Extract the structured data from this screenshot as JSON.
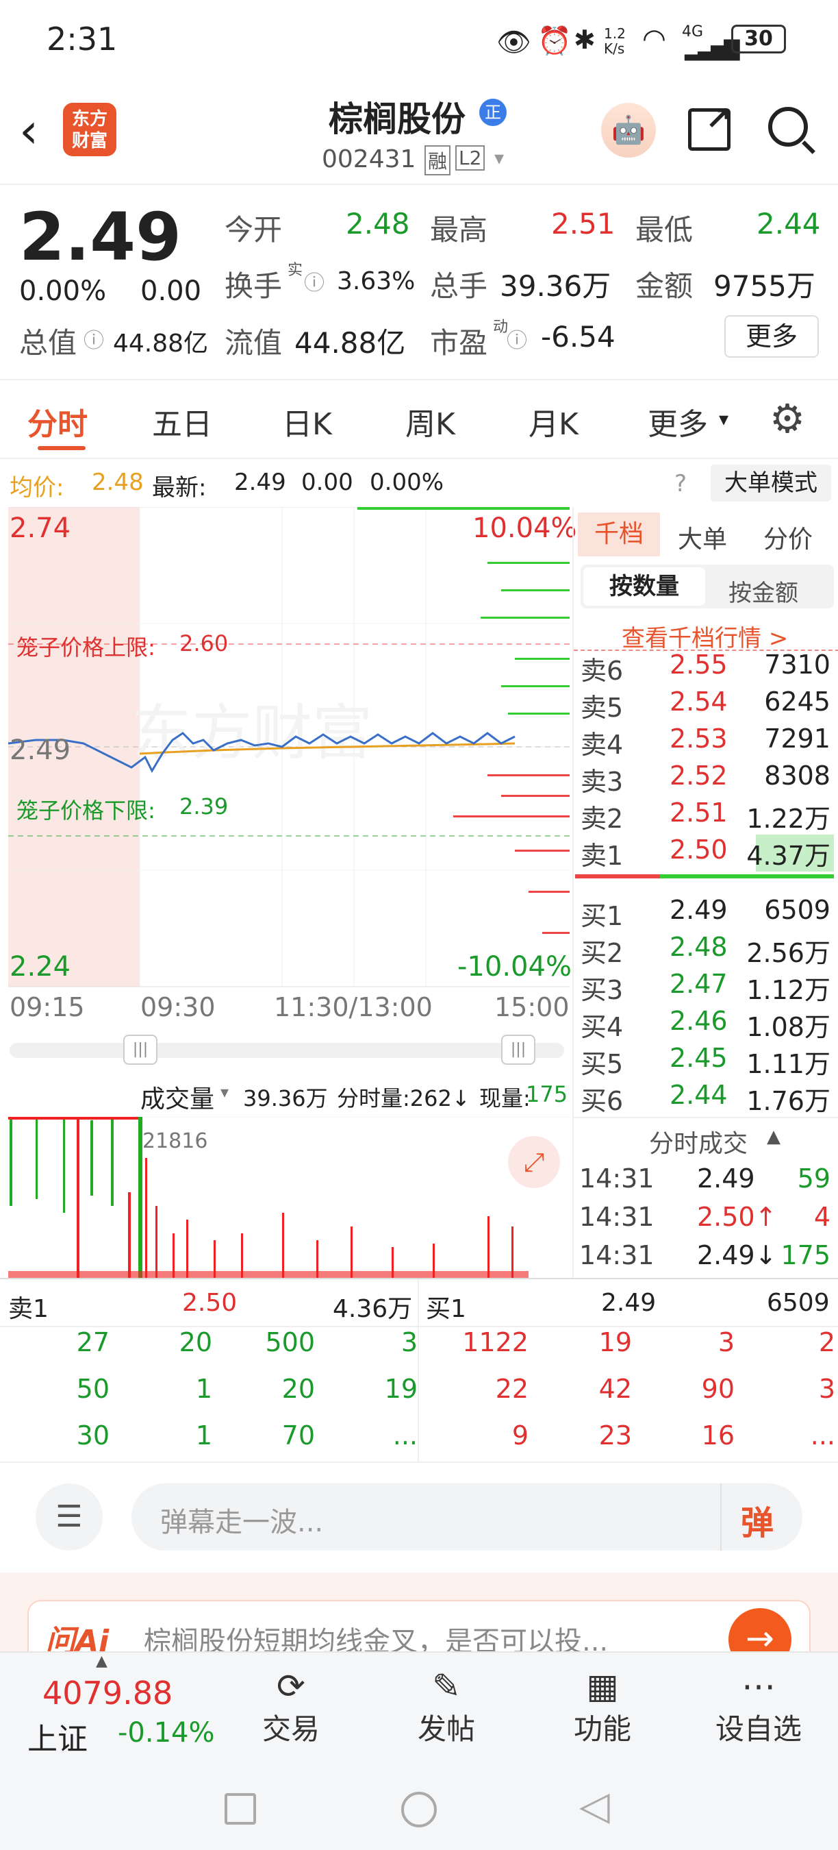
{
  "status_bar": {
    "time": "2:31",
    "net_speed": "1.2 K/s",
    "signal": "4G",
    "battery": "30"
  },
  "header": {
    "logo_text_1": "东方",
    "logo_text_2": "财富",
    "title": "棕榈股份",
    "badge": "正",
    "code": "002431",
    "tag_rong": "融",
    "tag_l2": "L2"
  },
  "quote": {
    "price": "2.49",
    "change_pct": "0.00%",
    "change": "0.00",
    "open_label": "今开",
    "open": "2.48",
    "high_label": "最高",
    "high": "2.51",
    "low_label": "最低",
    "low": "2.44",
    "turnover_label": "换手",
    "turnover_sup": "实",
    "turnover": "3.63%",
    "volume_label": "总手",
    "volume": "39.36万",
    "amount_label": "金额",
    "amount": "9755万",
    "mktcap_label": "总值",
    "mktcap": "44.88亿",
    "float_label": "流值",
    "float": "44.88亿",
    "pe_label": "市盈",
    "pe_sup": "动",
    "pe": "-6.54",
    "more": "更多"
  },
  "tabs": [
    "分时",
    "五日",
    "日K",
    "周K",
    "月K",
    "更多"
  ],
  "chart_info": {
    "avg_label": "均价:",
    "avg": "2.48",
    "latest_label": "最新:",
    "latest": "2.49",
    "chg": "0.00",
    "chg_pct": "0.00%",
    "big_order_mode": "大单模式"
  },
  "chart_data": {
    "type": "line",
    "y_max": "2.74",
    "y_min": "2.24",
    "y_mid": "2.49",
    "pct_max": "10.04%",
    "pct_min": "-10.04%",
    "upper_limit_label": "笼子价格上限:",
    "upper_limit": "2.60",
    "lower_limit_label": "笼子价格下限:",
    "lower_limit": "2.39",
    "x_labels": [
      "09:15",
      "09:30",
      "11:30/13:00",
      "15:00"
    ],
    "watermark": "东方财富"
  },
  "volume_bar": {
    "label": "成交量",
    "total": "39.36万",
    "tick_label": "分时量:262↓",
    "now_label": "现量:",
    "now": "175",
    "peak": "21816"
  },
  "orderbook": {
    "tabs": [
      "千档",
      "大单",
      "分价"
    ],
    "sub_tabs": [
      "按数量",
      "按金额"
    ],
    "link": "查看千档行情 >",
    "asks": [
      {
        "label": "卖6",
        "price": "2.55",
        "vol": "7310"
      },
      {
        "label": "卖5",
        "price": "2.54",
        "vol": "6245"
      },
      {
        "label": "卖4",
        "price": "2.53",
        "vol": "7291"
      },
      {
        "label": "卖3",
        "price": "2.52",
        "vol": "8308"
      },
      {
        "label": "卖2",
        "price": "2.51",
        "vol": "1.22万"
      },
      {
        "label": "卖1",
        "price": "2.50",
        "vol": "4.37万"
      }
    ],
    "bids": [
      {
        "label": "买1",
        "price": "2.49",
        "vol": "6509"
      },
      {
        "label": "买2",
        "price": "2.48",
        "vol": "2.56万"
      },
      {
        "label": "买3",
        "price": "2.47",
        "vol": "1.12万"
      },
      {
        "label": "买4",
        "price": "2.46",
        "vol": "1.08万"
      },
      {
        "label": "买5",
        "price": "2.45",
        "vol": "1.11万"
      },
      {
        "label": "买6",
        "price": "2.44",
        "vol": "1.76万"
      }
    ]
  },
  "ticks": {
    "title": "分时成交",
    "rows": [
      {
        "t": "14:31",
        "p": "2.49",
        "v": "59"
      },
      {
        "t": "14:31",
        "p": "2.50↑",
        "v": "4"
      },
      {
        "t": "14:31",
        "p": "2.49↓",
        "v": "175"
      }
    ]
  },
  "queue": {
    "sell_label": "卖1",
    "sell_price": "2.50",
    "sell_vol": "4.36万",
    "buy_label": "买1",
    "buy_price": "2.49",
    "buy_vol": "6509",
    "sell_rows": [
      [
        "27",
        "20",
        "500",
        "3"
      ],
      [
        "50",
        "1",
        "20",
        "19"
      ],
      [
        "30",
        "1",
        "70",
        "..."
      ]
    ],
    "buy_rows": [
      [
        "1122",
        "19",
        "3",
        "2"
      ],
      [
        "22",
        "42",
        "90",
        "3"
      ],
      [
        "9",
        "23",
        "16",
        "..."
      ]
    ]
  },
  "danmaku": {
    "placeholder": "弹幕走一波...",
    "btn": "弹"
  },
  "ai_banner": {
    "brand": "问Ai",
    "text": "棕榈股份短期均线金叉，是否可以投..."
  },
  "bottom_nav": {
    "index_value": "4079.88",
    "index_name": "上证",
    "index_chg": "-0.14%",
    "items": [
      "交易",
      "发帖",
      "功能",
      "设自选"
    ]
  }
}
